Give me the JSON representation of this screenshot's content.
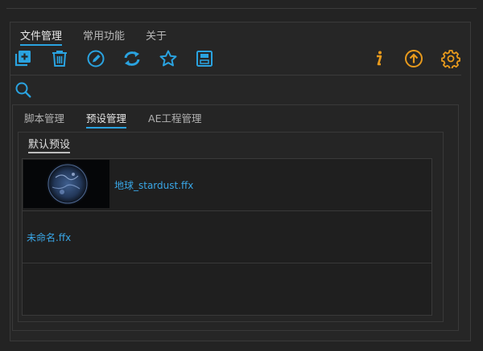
{
  "main_tabs": [
    {
      "label": "文件管理",
      "active": true
    },
    {
      "label": "常用功能",
      "active": false
    },
    {
      "label": "关于",
      "active": false
    }
  ],
  "toolbar": {
    "left_icons": [
      "add-file-icon",
      "trash-icon",
      "edit-icon",
      "refresh-icon",
      "star-icon",
      "save-icon"
    ],
    "right_icons": [
      "info-icon",
      "upload-icon",
      "settings-icon"
    ],
    "accent_blue": "#2aa3e0",
    "accent_orange": "#e89a1c"
  },
  "search": {
    "icon": "search-icon"
  },
  "sub_tabs": [
    {
      "label": "脚本管理",
      "active": false
    },
    {
      "label": "预设管理",
      "active": true
    },
    {
      "label": "AE工程管理",
      "active": false
    }
  ],
  "preset_group": {
    "label": "默认预设"
  },
  "presets": [
    {
      "name": "地球_stardust.ffx",
      "has_thumbnail": true
    },
    {
      "name": "未命名.ffx",
      "has_thumbnail": false
    }
  ]
}
